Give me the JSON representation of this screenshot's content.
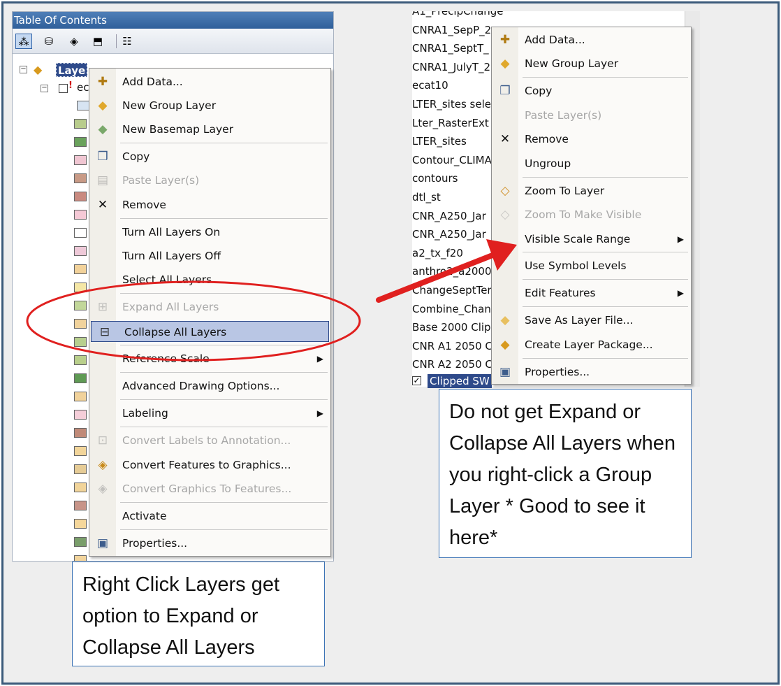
{
  "toc": {
    "title": "Table Of Contents",
    "root_layer": "Laye",
    "child_layer": "ec",
    "swatch_colors": [
      "#d7e4f2",
      "#b8cc8c",
      "#6aa25c",
      "#f0c6d2",
      "#c89a86",
      "#c98a80",
      "#f5c9d6",
      "#ffffff",
      "#eec9d8",
      "#f2d29a",
      "#f5e7a6",
      "#c2d79a",
      "#f1d39c",
      "#b7cf8e",
      "#b9cf8b",
      "#5f9a54",
      "#f1d29b",
      "#f5ced9",
      "#c08a78",
      "#f2d59a",
      "#e6cc96",
      "#f1d49a",
      "#c79488",
      "#f5d79b",
      "#7a9e6b",
      "#f2d49c"
    ]
  },
  "left_menu": {
    "items": [
      {
        "label": "Add Data...",
        "icon": "add-data-icon",
        "glyph": "✚",
        "color": "#b07b12",
        "disabled": false
      },
      {
        "label": "New Group Layer",
        "icon": "group-layer-icon",
        "glyph": "◆",
        "color": "#e0a82c",
        "disabled": false
      },
      {
        "label": "New Basemap Layer",
        "icon": "basemap-layer-icon",
        "glyph": "◆",
        "color": "#7aa86a",
        "disabled": false
      },
      {
        "label": "Copy",
        "icon": "copy-icon",
        "glyph": "❐",
        "color": "#3d5d8c",
        "disabled": false
      },
      {
        "label": "Paste Layer(s)",
        "icon": "paste-icon",
        "glyph": "▤",
        "color": "#777",
        "disabled": true
      },
      {
        "label": "Remove",
        "icon": "remove-icon",
        "glyph": "✕",
        "color": "#111",
        "disabled": false
      },
      {
        "label": "Turn All Layers On",
        "icon": "",
        "glyph": "",
        "color": "#111",
        "disabled": false
      },
      {
        "label": "Turn All Layers Off",
        "icon": "",
        "glyph": "",
        "color": "#111",
        "disabled": false
      },
      {
        "label": "Select All Layers",
        "icon": "",
        "glyph": "",
        "color": "#111",
        "disabled": false
      },
      {
        "label": "Expand All Layers",
        "icon": "expand-icon",
        "glyph": "⊞",
        "color": "#888",
        "disabled": true
      },
      {
        "label": "Collapse All Layers",
        "icon": "collapse-icon",
        "glyph": "⊟",
        "color": "#333",
        "disabled": false
      },
      {
        "label": "Reference Scale",
        "icon": "",
        "glyph": "",
        "color": "#111",
        "disabled": false,
        "submenu": true
      },
      {
        "label": "Advanced Drawing Options...",
        "icon": "",
        "glyph": "",
        "color": "#111",
        "disabled": false
      },
      {
        "label": "Labeling",
        "icon": "",
        "glyph": "",
        "color": "#111",
        "disabled": false,
        "submenu": true
      },
      {
        "label": "Convert Labels to Annotation...",
        "icon": "convert-labels-icon",
        "glyph": "⊡",
        "color": "#888",
        "disabled": true
      },
      {
        "label": "Convert Features to Graphics...",
        "icon": "convert-features-icon",
        "glyph": "◈",
        "color": "#c88a1a",
        "disabled": false
      },
      {
        "label": "Convert Graphics To Features...",
        "icon": "convert-graphics-icon",
        "glyph": "◈",
        "color": "#888",
        "disabled": true
      },
      {
        "label": "Activate",
        "icon": "",
        "glyph": "",
        "color": "#111",
        "disabled": false
      },
      {
        "label": "Properties...",
        "icon": "properties-icon",
        "glyph": "▣",
        "color": "#3d5d8c",
        "disabled": false
      }
    ]
  },
  "right_menu": {
    "items": [
      {
        "label": "Add Data...",
        "icon": "add-data-icon",
        "glyph": "✚",
        "color": "#b07b12",
        "disabled": false
      },
      {
        "label": "New Group Layer",
        "icon": "group-layer-icon",
        "glyph": "◆",
        "color": "#e0a82c",
        "disabled": false
      },
      {
        "label": "Copy",
        "icon": "copy-icon",
        "glyph": "❐",
        "color": "#3d5d8c",
        "disabled": false
      },
      {
        "label": "Paste Layer(s)",
        "icon": "",
        "glyph": "",
        "color": "#888",
        "disabled": true
      },
      {
        "label": "Remove",
        "icon": "remove-icon",
        "glyph": "✕",
        "color": "#111",
        "disabled": false
      },
      {
        "label": "Ungroup",
        "icon": "",
        "glyph": "",
        "color": "#111",
        "disabled": false
      },
      {
        "label": "Zoom To Layer",
        "icon": "zoom-to-layer-icon",
        "glyph": "◇",
        "color": "#d0902a",
        "disabled": false
      },
      {
        "label": "Zoom To Make Visible",
        "icon": "zoom-visible-icon",
        "glyph": "◇",
        "color": "#999",
        "disabled": true
      },
      {
        "label": "Visible Scale Range",
        "icon": "",
        "glyph": "",
        "color": "#111",
        "disabled": false,
        "submenu": true
      },
      {
        "label": "Use Symbol Levels",
        "icon": "",
        "glyph": "",
        "color": "#111",
        "disabled": false
      },
      {
        "label": "Edit Features",
        "icon": "",
        "glyph": "",
        "color": "#111",
        "disabled": false,
        "submenu": true
      },
      {
        "label": "Save As Layer File...",
        "icon": "layer-file-icon",
        "glyph": "◆",
        "color": "#e8c060",
        "disabled": false
      },
      {
        "label": "Create Layer Package...",
        "icon": "layer-package-icon",
        "glyph": "◆",
        "color": "#d89a1e",
        "disabled": false
      },
      {
        "label": "Properties...",
        "icon": "properties-icon",
        "glyph": "▣",
        "color": "#3d5d8c",
        "disabled": false
      }
    ]
  },
  "layer_list": {
    "items": [
      "A1_PrecipChange",
      "CNRA1_SepP_2",
      "CNRA1_SeptT_",
      "CNRA1_JulyT_2",
      "ecat10",
      "LTER_sites sele",
      "Lter_RasterExt",
      "LTER_sites",
      "Contour_CLIMA",
      "contours",
      "dtl_st",
      "CNR_A250_Jar",
      "CNR_A250_Jar",
      "a2_tx_f20",
      "anthro2_a2000",
      "ChangeSeptTer",
      "Combine_Chan",
      "Base 2000 Clipp",
      "CNR A1 2050 C",
      "CNR A2 2050 C"
    ],
    "selected_item": "Clipped SW"
  },
  "notes": {
    "left": "Right Click Layers get option to Expand or Collapse All Layers",
    "right": "Do not get Expand or Collapse All Layers when you right-click a Group Layer * Good to see it here*"
  },
  "colors": {
    "ellipse": "#e0201f",
    "arrow": "#e0201f",
    "note_border": "#3c73b5",
    "frame_border": "#3b5a7a"
  }
}
